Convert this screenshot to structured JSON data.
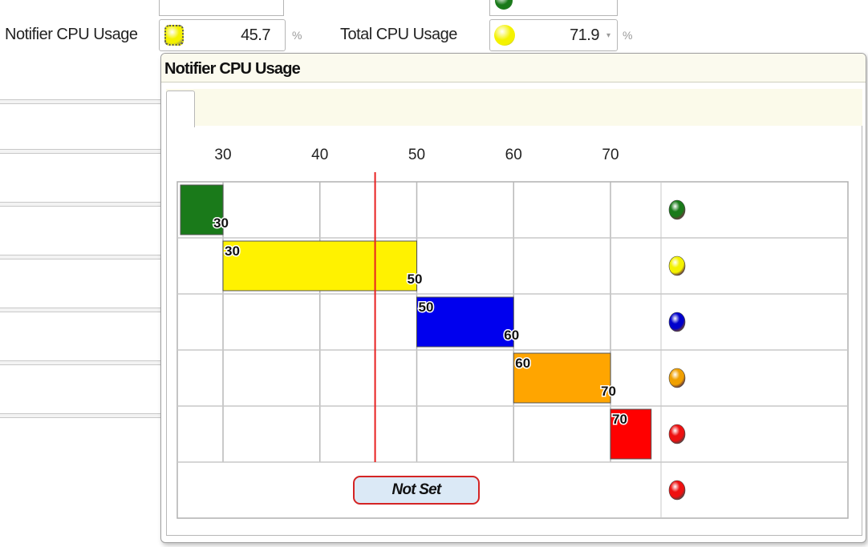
{
  "fields": {
    "notifier_cpu": {
      "label": "Notifier CPU Usage",
      "value": "45.7",
      "unit": "%",
      "led_color": "#f4f200"
    },
    "total_cpu": {
      "label": "Total CPU Usage",
      "value": "71.9",
      "unit": "%",
      "led_color": "#f4f200"
    },
    "top_stub_led_color": "#1a7a1a"
  },
  "popup": {
    "title": "Notifier CPU Usage",
    "not_set_label": "Not Set"
  },
  "chart_data": {
    "type": "bar",
    "orientation": "horizontal-range",
    "x_ticks": [
      30,
      40,
      50,
      60,
      70
    ],
    "xlim": [
      25.5,
      80
    ],
    "current_value": 45.7,
    "grid": true,
    "bands": [
      {
        "start": 25.5,
        "end": 30,
        "start_label": "",
        "end_label": "30",
        "color": "#1a7a1a",
        "led_color": "#1a7a1a"
      },
      {
        "start": 30,
        "end": 50,
        "start_label": "30",
        "end_label": "50",
        "color": "#fff200",
        "led_color": "#f4f200"
      },
      {
        "start": 50,
        "end": 60,
        "start_label": "50",
        "end_label": "60",
        "color": "#0000ee",
        "led_color": "#0000cc"
      },
      {
        "start": 60,
        "end": 70,
        "start_label": "60",
        "end_label": "70",
        "color": "#ffa500",
        "led_color": "#f0a000"
      },
      {
        "start": 70,
        "end": 74.2,
        "start_label": "70",
        "end_label": "",
        "color": "#ff0000",
        "led_color": "#ee1111"
      }
    ],
    "not_set_led_color": "#ee1111"
  }
}
